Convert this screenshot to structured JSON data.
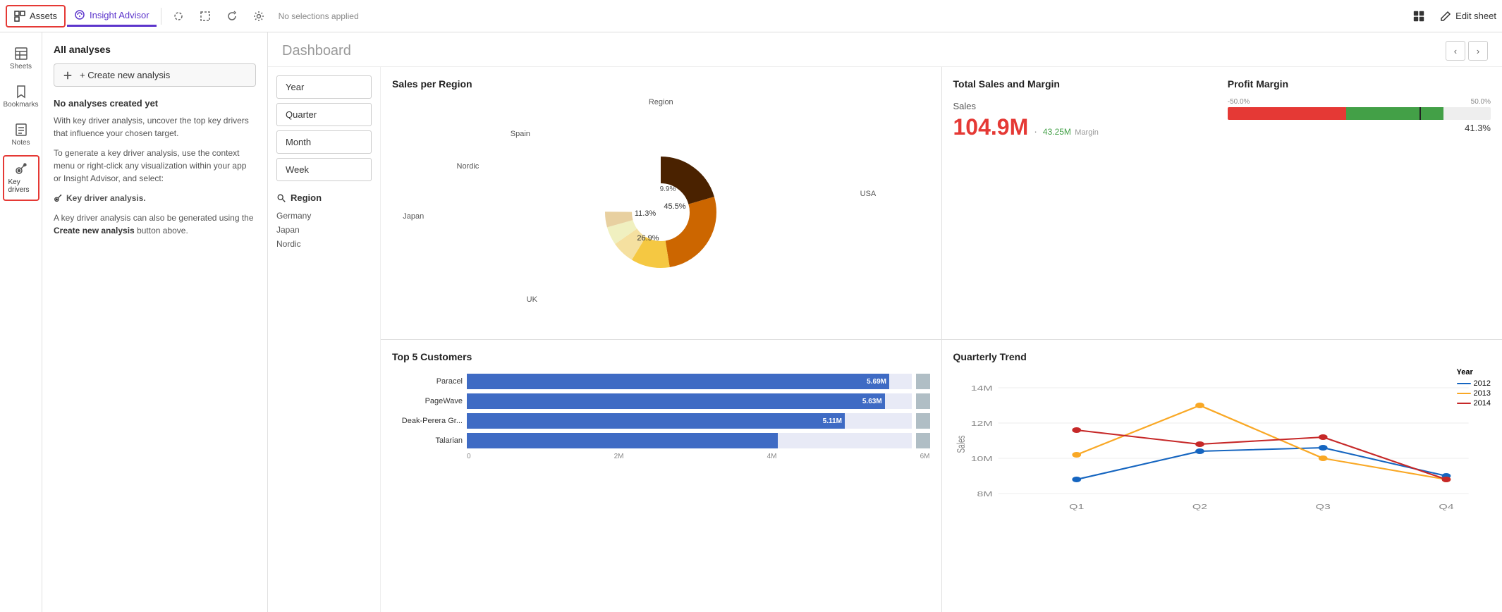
{
  "topbar": {
    "assets_label": "Assets",
    "insight_advisor_label": "Insight Advisor",
    "no_selections": "No selections applied",
    "edit_sheet_label": "Edit sheet"
  },
  "sidebar_icons": [
    {
      "id": "sheets",
      "label": "Sheets",
      "icon": "grid"
    },
    {
      "id": "bookmarks",
      "label": "Bookmarks",
      "icon": "bookmark"
    },
    {
      "id": "notes",
      "label": "Notes",
      "icon": "note"
    },
    {
      "id": "key_drivers",
      "label": "Key drivers",
      "icon": "key"
    }
  ],
  "analysis_panel": {
    "all_analyses": "All analyses",
    "create_btn": "+ Create new analysis",
    "no_analyses": "No analyses created yet",
    "desc1": "With key driver analysis, uncover the top key drivers that influence your chosen target.",
    "desc2": "To generate a key driver analysis, use the context menu or right-click any visualization within your app or Insight Advisor, and select:",
    "key_driver_label": "Key driver analysis.",
    "desc3": "A key driver analysis can also be generated using the",
    "create_link": "Create new analysis",
    "desc3_end": "button above."
  },
  "filter_buttons": [
    "Year",
    "Quarter",
    "Month",
    "Week"
  ],
  "filter_region": {
    "title": "Region",
    "items": [
      "Germany",
      "Japan",
      "Nordic"
    ]
  },
  "dashboard": {
    "title": "Dashboard"
  },
  "sales_per_region": {
    "title": "Sales per Region",
    "legend_label": "Region",
    "segments": [
      {
        "label": "USA",
        "pct": "45.5%",
        "color": "#4a2200"
      },
      {
        "label": "UK",
        "pct": "26.9%",
        "color": "#cc6600"
      },
      {
        "label": "Japan",
        "pct": "11.3%",
        "color": "#f5c842"
      },
      {
        "label": "Nordic",
        "pct": "",
        "color": "#f5e8a0"
      },
      {
        "label": "Spain",
        "pct": "",
        "color": "#f0f0c0"
      },
      {
        "label": "9.9%",
        "color": "#e8d0a0"
      }
    ]
  },
  "total_sales": {
    "title": "Total Sales and Margin",
    "sales_label": "Sales",
    "sales_value": "104.9M",
    "margin_value": "43.25M",
    "margin_label": "Margin"
  },
  "profit_margin": {
    "title": "Profit Margin",
    "scale_left": "-50.0%",
    "scale_right": "50.0%",
    "value": "41.3%"
  },
  "quarterly_trend": {
    "title": "Quarterly Trend",
    "y_axis": "Sales",
    "y_max": "14M",
    "y_mid": "12M",
    "y_low": "10M",
    "y_min": "8M",
    "x_labels": [
      "Q1",
      "Q2",
      "Q3",
      "Q4"
    ],
    "legend_title": "Year",
    "series": [
      {
        "year": "2012",
        "color": "#1565c0"
      },
      {
        "year": "2013",
        "color": "#f9a825"
      },
      {
        "year": "2014",
        "color": "#c62828"
      }
    ]
  },
  "top5_customers": {
    "title": "Top 5 Customers",
    "customers": [
      {
        "name": "Paracel",
        "value": "5.69M",
        "pct": 95
      },
      {
        "name": "PageWave",
        "value": "5.63M",
        "pct": 94
      },
      {
        "name": "Deak-Perera Gr...",
        "value": "5.11M",
        "pct": 85
      },
      {
        "name": "Talarian",
        "value": "",
        "pct": 70
      }
    ],
    "axis_labels": [
      "0",
      "2M",
      "4M",
      "6M"
    ]
  }
}
